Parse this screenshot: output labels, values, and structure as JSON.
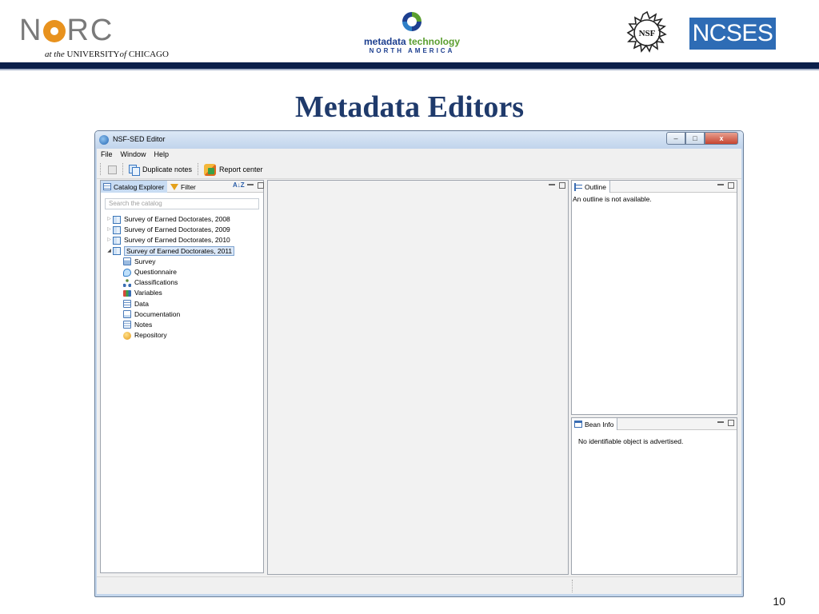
{
  "slide": {
    "title": "Metadata Editors",
    "page_number": "10"
  },
  "logos": {
    "norc": {
      "word_n": "N",
      "word_rc": "RC",
      "subtitle_at_the": "at the",
      "subtitle_university": " UNIVERSITY",
      "subtitle_of": "of",
      "subtitle_chicago": " CHICAGO"
    },
    "mtna": {
      "line1_a": "metadata",
      "line1_b": " technology",
      "line2": "NORTH AMERICA"
    },
    "nsf": {
      "text": "NSF"
    },
    "ncses": {
      "text": "NCSES"
    }
  },
  "colors": {
    "header_rule": "#0b1f4a",
    "title": "#1f3a6b",
    "ncses_bg": "#2e6cb5",
    "norc_orange": "#e8921e"
  },
  "window": {
    "title": "NSF-SED Editor",
    "controls": {
      "minimize": "–",
      "maximize": "□",
      "close": "x"
    },
    "menu": [
      "File",
      "Window",
      "Help"
    ],
    "toolbar": {
      "duplicate_notes": "Duplicate notes",
      "report_center": "Report center"
    },
    "catalog_panel": {
      "tab_catalog": "Catalog Explorer",
      "tab_filter": "Filter",
      "sort_icon": "A↓Z",
      "search_placeholder": "Search the catalog",
      "surveys": [
        {
          "label": "Survey of Earned Doctorates, 2008",
          "expanded": false
        },
        {
          "label": "Survey of Earned Doctorates, 2009",
          "expanded": false
        },
        {
          "label": "Survey of Earned Doctorates, 2010",
          "expanded": false
        },
        {
          "label": "Survey of Earned Doctorates, 2011",
          "expanded": true,
          "selected": true
        }
      ],
      "children": [
        "Survey",
        "Questionnaire",
        "Classifications",
        "Variables",
        "Data",
        "Documentation",
        "Notes",
        "Repository"
      ]
    },
    "outline_panel": {
      "tab": "Outline",
      "message": "An outline is not available."
    },
    "bean_panel": {
      "tab": "Bean Info",
      "message": "No identifiable object is advertised."
    }
  }
}
